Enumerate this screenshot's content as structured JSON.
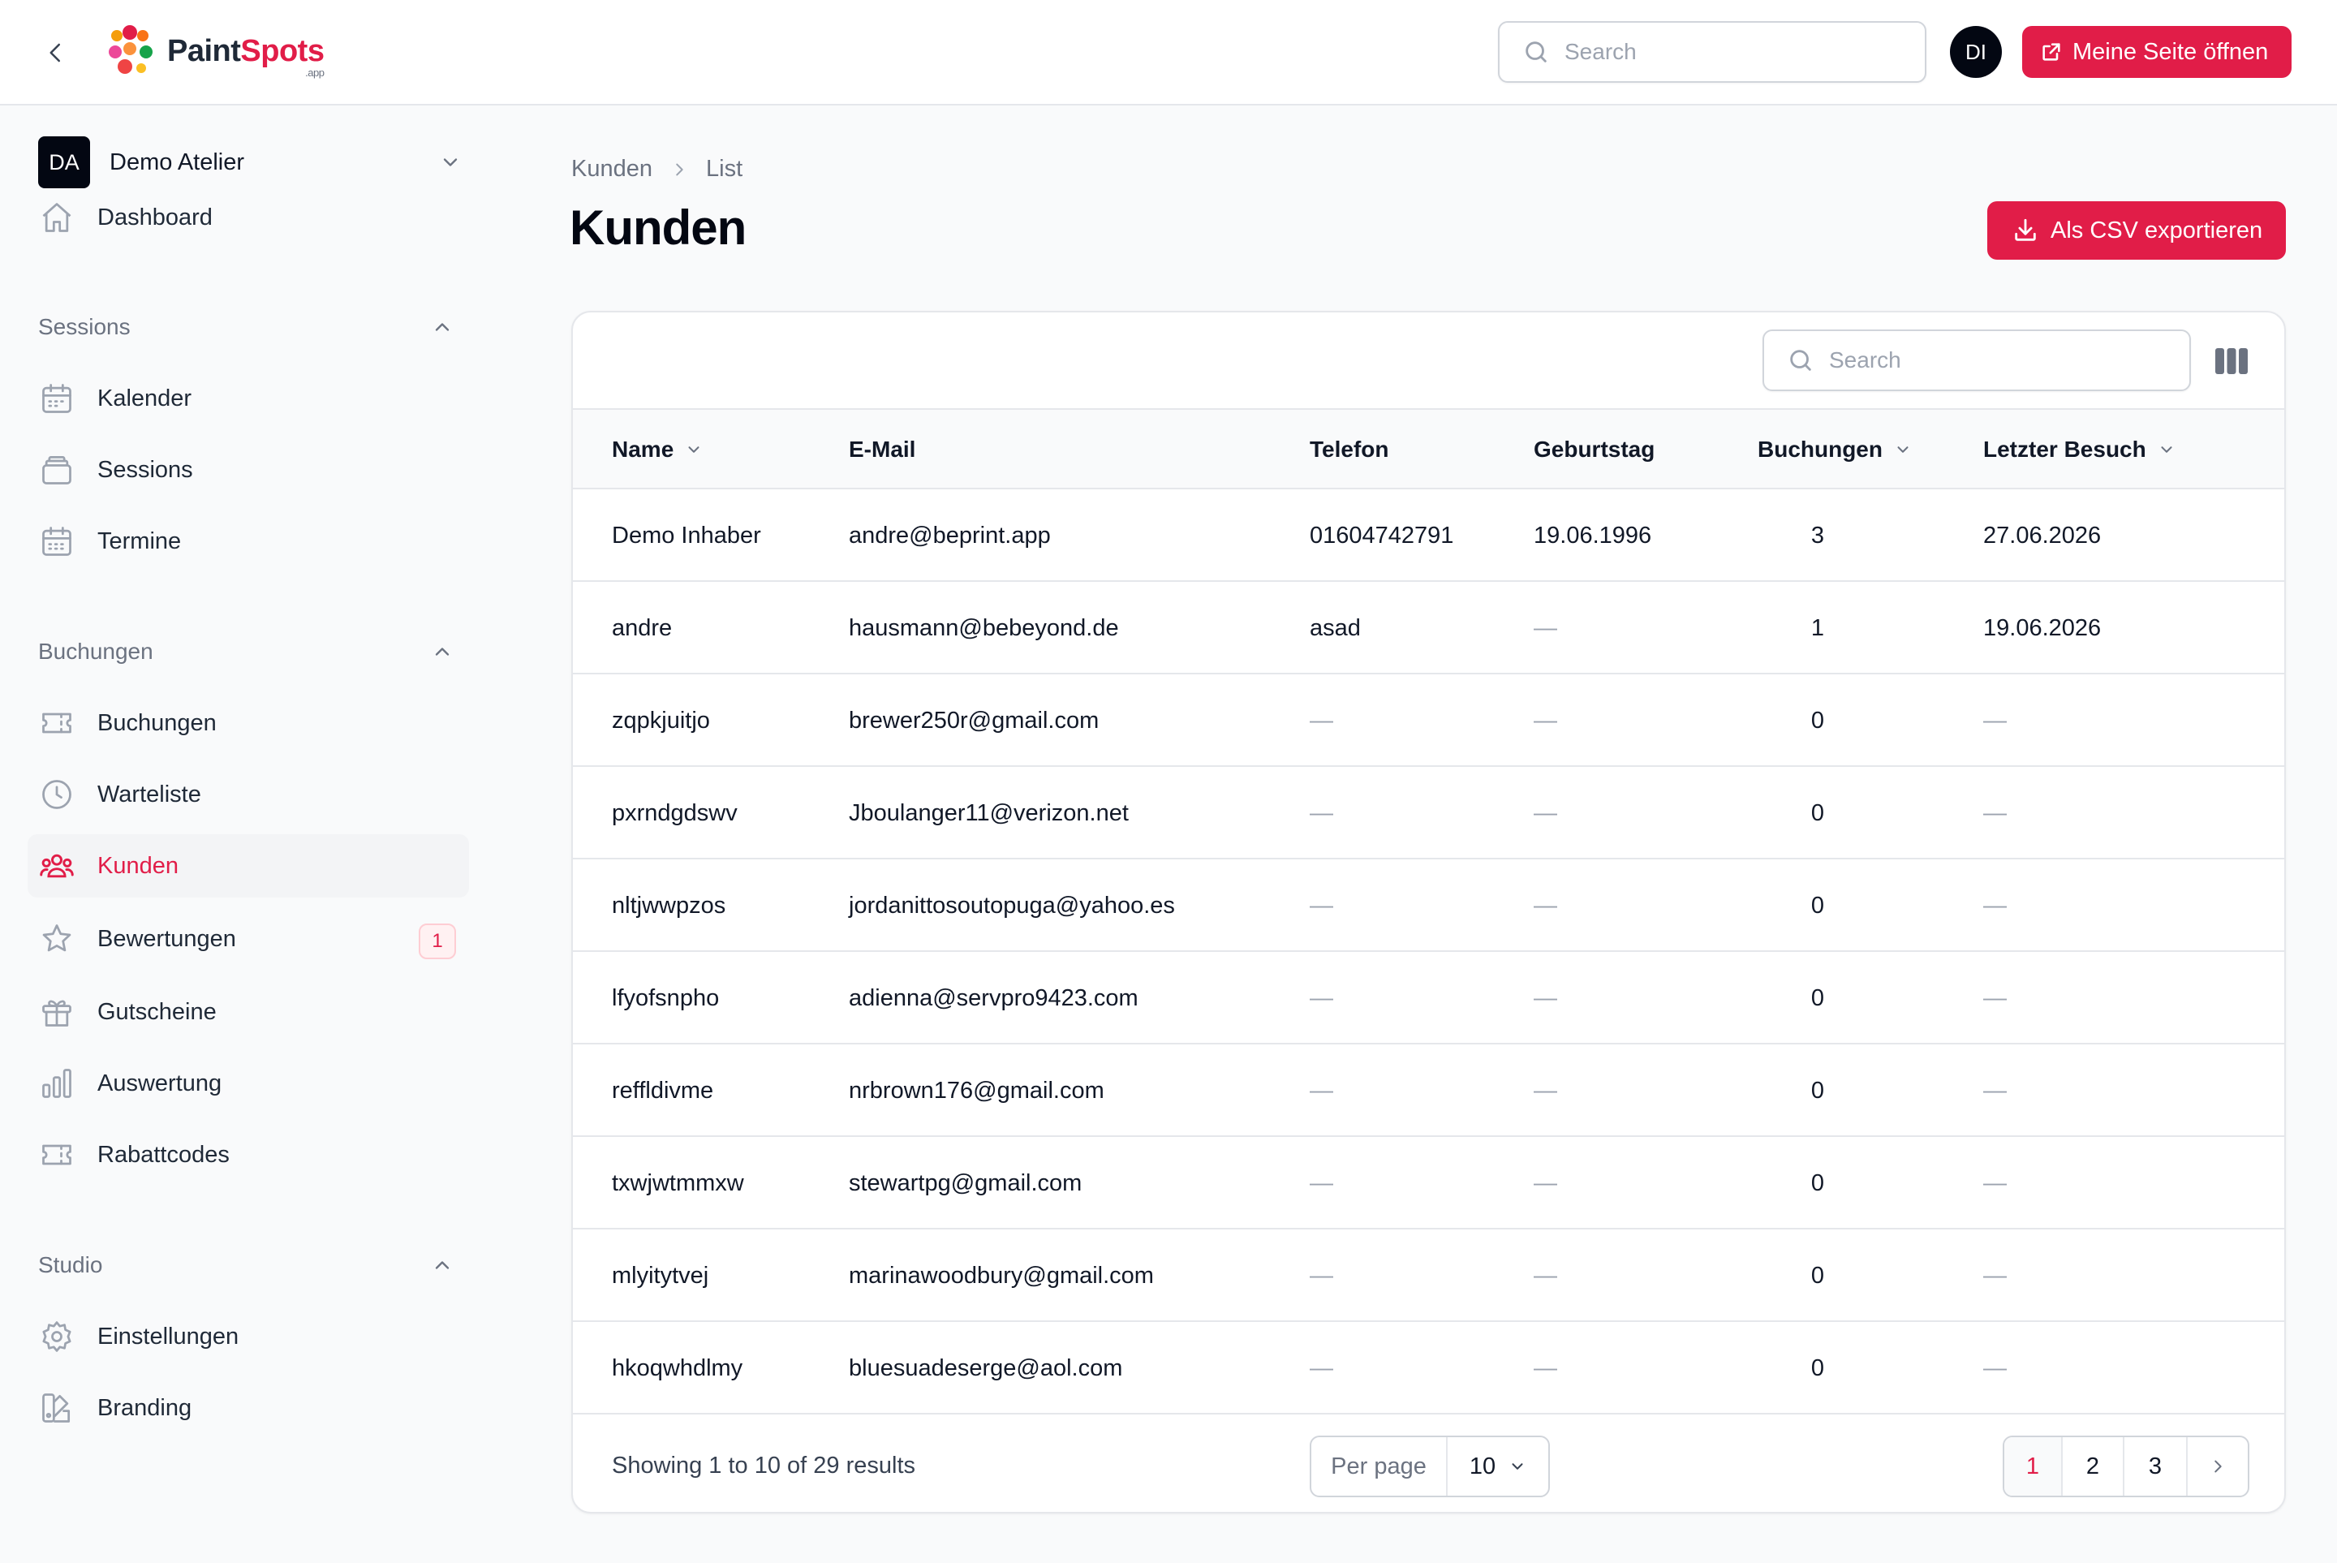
{
  "header": {
    "logo_paint": "Paint",
    "logo_spots": "Spots",
    "logo_domain": ".app",
    "search_placeholder": "Search",
    "avatar_initials": "DI",
    "open_page_label": "Meine Seite öffnen",
    "accent_color": "#e11d48"
  },
  "sidebar": {
    "tenant_initials": "DA",
    "tenant_name": "Demo Atelier",
    "dashboard": "Dashboard",
    "groups": {
      "sessions": {
        "label": "Sessions",
        "items": [
          "Kalender",
          "Sessions",
          "Termine"
        ]
      },
      "buchungen": {
        "label": "Buchungen",
        "items": [
          "Buchungen",
          "Warteliste",
          "Kunden",
          "Bewertungen",
          "Gutscheine",
          "Auswertung",
          "Rabattcodes"
        ]
      },
      "studio": {
        "label": "Studio",
        "items": [
          "Einstellungen",
          "Branding"
        ]
      }
    },
    "active_item": "Kunden",
    "bewertungen_badge": "1"
  },
  "main": {
    "breadcrumb": [
      "Kunden",
      "List"
    ],
    "title": "Kunden",
    "export_label": "Als CSV exportieren",
    "table_search_placeholder": "Search",
    "columns": [
      "Name",
      "E-Mail",
      "Telefon",
      "Geburtstag",
      "Buchungen",
      "Letzter Besuch"
    ],
    "rows": [
      [
        "Demo Inhaber",
        "andre@beprint.app",
        "01604742791",
        "19.06.1996",
        "3",
        "27.06.2026"
      ],
      [
        "andre",
        "hausmann@bebeyond.de",
        "asad",
        "—",
        "1",
        "19.06.2026"
      ],
      [
        "zqpkjuitjo",
        "brewer250r@gmail.com",
        "—",
        "—",
        "0",
        "—"
      ],
      [
        "pxrndgdswv",
        "Jboulanger11@verizon.net",
        "—",
        "—",
        "0",
        "—"
      ],
      [
        "nltjwwpzos",
        "jordanittosoutopuga@yahoo.es",
        "—",
        "—",
        "0",
        "—"
      ],
      [
        "lfyofsnpho",
        "adienna@servpro9423.com",
        "—",
        "—",
        "0",
        "—"
      ],
      [
        "reffldivme",
        "nrbrown176@gmail.com",
        "—",
        "—",
        "0",
        "—"
      ],
      [
        "txwjwtmmxw",
        "stewartpg@gmail.com",
        "—",
        "—",
        "0",
        "—"
      ],
      [
        "mlyitytvej",
        "marinawoodbury@gmail.com",
        "—",
        "—",
        "0",
        "—"
      ],
      [
        "hkoqwhdlmy",
        "bluesuadeserge@aol.com",
        "—",
        "—",
        "0",
        "—"
      ]
    ],
    "results_text": "Showing 1 to 10 of 29 results",
    "per_page_label": "Per page",
    "per_page_value": "10",
    "pages": [
      "1",
      "2",
      "3"
    ],
    "current_page": "1"
  }
}
